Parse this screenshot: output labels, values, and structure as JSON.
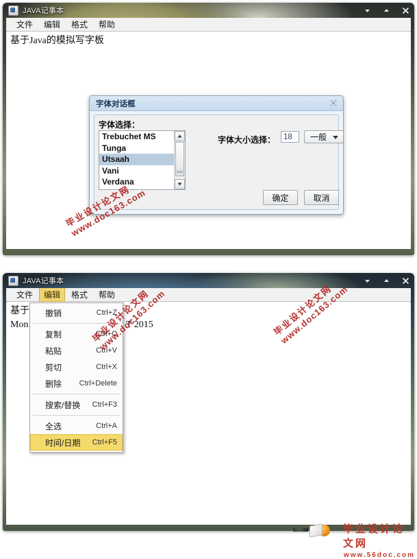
{
  "window1": {
    "title": "JAVA记事本",
    "icon": "app-icon",
    "buttons": {
      "minimize": "▼",
      "maximize": "▲",
      "close": "✕"
    },
    "menubar": [
      {
        "label": "文件",
        "active": false
      },
      {
        "label": "编辑",
        "active": false
      },
      {
        "label": "格式",
        "active": false
      },
      {
        "label": "帮助",
        "active": false
      }
    ],
    "text_lines": [
      "基于Java的模拟写字板"
    ]
  },
  "dialog": {
    "title": "字体对话框",
    "close_icon": "✕",
    "font_label": "字体选择：",
    "font_list": [
      {
        "name": "Trebuchet MS",
        "selected": false
      },
      {
        "name": "Tunga",
        "selected": false
      },
      {
        "name": "Utsaah",
        "selected": true
      },
      {
        "name": "Vani",
        "selected": false
      },
      {
        "name": "Verdana",
        "selected": false
      }
    ],
    "scrollbar": {
      "up": "▲",
      "down": "▼"
    },
    "size_label": "字体大小选择：",
    "size_value": "18",
    "style_value": "一般",
    "ok_label": "确定",
    "cancel_label": "取消"
  },
  "window2": {
    "title": "JAVA记事本",
    "icon": "app-icon",
    "buttons": {
      "minimize": "▼",
      "maximize": "▲",
      "close": "✕"
    },
    "menubar": [
      {
        "label": "文件",
        "active": false
      },
      {
        "label": "编辑",
        "active": true
      },
      {
        "label": "格式",
        "active": false
      },
      {
        "label": "帮助",
        "active": false
      }
    ],
    "text_lines": [
      "基于",
      "Mon",
      "T  2015"
    ],
    "edit_menu": [
      {
        "label": "撤销",
        "accel": "Ctrl+Z",
        "selected": false,
        "sep_after": true
      },
      {
        "label": "复制",
        "accel": "Ctrl+C",
        "selected": false,
        "sep_after": false
      },
      {
        "label": "粘贴",
        "accel": "Ctrl+V",
        "selected": false,
        "sep_after": false
      },
      {
        "label": "剪切",
        "accel": "Ctrl+X",
        "selected": false,
        "sep_after": false
      },
      {
        "label": "删除",
        "accel": "Ctrl+Delete",
        "selected": false,
        "sep_after": true
      },
      {
        "label": "搜索/替换",
        "accel": "Ctrl+F3",
        "selected": false,
        "sep_after": true
      },
      {
        "label": "全选",
        "accel": "Ctrl+A",
        "selected": false,
        "sep_after": false
      },
      {
        "label": "时间/日期",
        "accel": "Ctrl+F5",
        "selected": true,
        "sep_after": false
      }
    ]
  },
  "watermarks": [
    {
      "line1": "毕业设计论文网",
      "line2": "www.doc163.com"
    },
    {
      "line1": "毕业设计论文网",
      "line2": "www.doc163.com"
    },
    {
      "line1": "毕业设计论文网",
      "line2": "www.doc163.com"
    }
  ],
  "footer": {
    "cn": "毕业设计论文网",
    "en": "www.56doc.com"
  },
  "colors": {
    "accent": "#b0211f",
    "menu_highlight": "#f4da6a",
    "list_selection": "#b9cde0",
    "dialog_titlebar": "#cfe0f0"
  }
}
